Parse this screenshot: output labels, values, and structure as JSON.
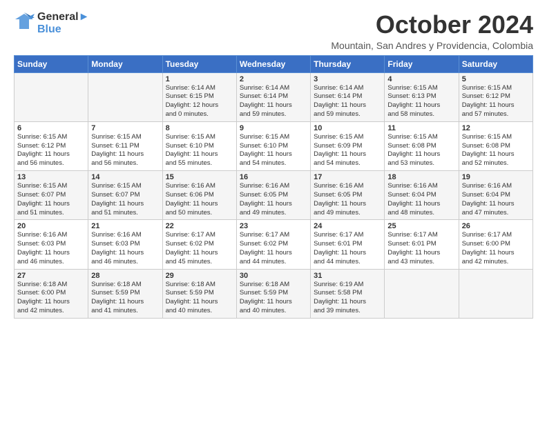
{
  "logo": {
    "line1": "General",
    "line2": "Blue"
  },
  "title": "October 2024",
  "subtitle": "Mountain, San Andres y Providencia, Colombia",
  "days_of_week": [
    "Sunday",
    "Monday",
    "Tuesday",
    "Wednesday",
    "Thursday",
    "Friday",
    "Saturday"
  ],
  "weeks": [
    [
      {
        "day": "",
        "info": ""
      },
      {
        "day": "",
        "info": ""
      },
      {
        "day": "1",
        "info": "Sunrise: 6:14 AM\nSunset: 6:15 PM\nDaylight: 12 hours\nand 0 minutes."
      },
      {
        "day": "2",
        "info": "Sunrise: 6:14 AM\nSunset: 6:14 PM\nDaylight: 11 hours\nand 59 minutes."
      },
      {
        "day": "3",
        "info": "Sunrise: 6:14 AM\nSunset: 6:14 PM\nDaylight: 11 hours\nand 59 minutes."
      },
      {
        "day": "4",
        "info": "Sunrise: 6:15 AM\nSunset: 6:13 PM\nDaylight: 11 hours\nand 58 minutes."
      },
      {
        "day": "5",
        "info": "Sunrise: 6:15 AM\nSunset: 6:12 PM\nDaylight: 11 hours\nand 57 minutes."
      }
    ],
    [
      {
        "day": "6",
        "info": "Sunrise: 6:15 AM\nSunset: 6:12 PM\nDaylight: 11 hours\nand 56 minutes."
      },
      {
        "day": "7",
        "info": "Sunrise: 6:15 AM\nSunset: 6:11 PM\nDaylight: 11 hours\nand 56 minutes."
      },
      {
        "day": "8",
        "info": "Sunrise: 6:15 AM\nSunset: 6:10 PM\nDaylight: 11 hours\nand 55 minutes."
      },
      {
        "day": "9",
        "info": "Sunrise: 6:15 AM\nSunset: 6:10 PM\nDaylight: 11 hours\nand 54 minutes."
      },
      {
        "day": "10",
        "info": "Sunrise: 6:15 AM\nSunset: 6:09 PM\nDaylight: 11 hours\nand 54 minutes."
      },
      {
        "day": "11",
        "info": "Sunrise: 6:15 AM\nSunset: 6:08 PM\nDaylight: 11 hours\nand 53 minutes."
      },
      {
        "day": "12",
        "info": "Sunrise: 6:15 AM\nSunset: 6:08 PM\nDaylight: 11 hours\nand 52 minutes."
      }
    ],
    [
      {
        "day": "13",
        "info": "Sunrise: 6:15 AM\nSunset: 6:07 PM\nDaylight: 11 hours\nand 51 minutes."
      },
      {
        "day": "14",
        "info": "Sunrise: 6:15 AM\nSunset: 6:07 PM\nDaylight: 11 hours\nand 51 minutes."
      },
      {
        "day": "15",
        "info": "Sunrise: 6:16 AM\nSunset: 6:06 PM\nDaylight: 11 hours\nand 50 minutes."
      },
      {
        "day": "16",
        "info": "Sunrise: 6:16 AM\nSunset: 6:05 PM\nDaylight: 11 hours\nand 49 minutes."
      },
      {
        "day": "17",
        "info": "Sunrise: 6:16 AM\nSunset: 6:05 PM\nDaylight: 11 hours\nand 49 minutes."
      },
      {
        "day": "18",
        "info": "Sunrise: 6:16 AM\nSunset: 6:04 PM\nDaylight: 11 hours\nand 48 minutes."
      },
      {
        "day": "19",
        "info": "Sunrise: 6:16 AM\nSunset: 6:04 PM\nDaylight: 11 hours\nand 47 minutes."
      }
    ],
    [
      {
        "day": "20",
        "info": "Sunrise: 6:16 AM\nSunset: 6:03 PM\nDaylight: 11 hours\nand 46 minutes."
      },
      {
        "day": "21",
        "info": "Sunrise: 6:16 AM\nSunset: 6:03 PM\nDaylight: 11 hours\nand 46 minutes."
      },
      {
        "day": "22",
        "info": "Sunrise: 6:17 AM\nSunset: 6:02 PM\nDaylight: 11 hours\nand 45 minutes."
      },
      {
        "day": "23",
        "info": "Sunrise: 6:17 AM\nSunset: 6:02 PM\nDaylight: 11 hours\nand 44 minutes."
      },
      {
        "day": "24",
        "info": "Sunrise: 6:17 AM\nSunset: 6:01 PM\nDaylight: 11 hours\nand 44 minutes."
      },
      {
        "day": "25",
        "info": "Sunrise: 6:17 AM\nSunset: 6:01 PM\nDaylight: 11 hours\nand 43 minutes."
      },
      {
        "day": "26",
        "info": "Sunrise: 6:17 AM\nSunset: 6:00 PM\nDaylight: 11 hours\nand 42 minutes."
      }
    ],
    [
      {
        "day": "27",
        "info": "Sunrise: 6:18 AM\nSunset: 6:00 PM\nDaylight: 11 hours\nand 42 minutes."
      },
      {
        "day": "28",
        "info": "Sunrise: 6:18 AM\nSunset: 5:59 PM\nDaylight: 11 hours\nand 41 minutes."
      },
      {
        "day": "29",
        "info": "Sunrise: 6:18 AM\nSunset: 5:59 PM\nDaylight: 11 hours\nand 40 minutes."
      },
      {
        "day": "30",
        "info": "Sunrise: 6:18 AM\nSunset: 5:59 PM\nDaylight: 11 hours\nand 40 minutes."
      },
      {
        "day": "31",
        "info": "Sunrise: 6:19 AM\nSunset: 5:58 PM\nDaylight: 11 hours\nand 39 minutes."
      },
      {
        "day": "",
        "info": ""
      },
      {
        "day": "",
        "info": ""
      }
    ]
  ]
}
